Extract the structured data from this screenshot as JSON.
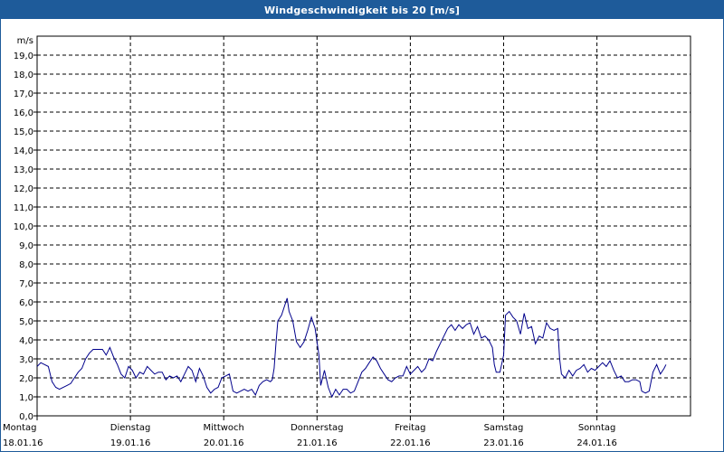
{
  "window": {
    "title": "Windgeschwindigkeit bis 20 [m/s]"
  },
  "colors": {
    "titlebar": "#1e5b9a",
    "series": "#00008b",
    "grid": "#000000"
  },
  "chart_data": {
    "type": "line",
    "title": "Windgeschwindigkeit bis 20 [m/s]",
    "ylabel": "m/s",
    "ylim": [
      0,
      20
    ],
    "y_ticks": [
      "0,0",
      "1,0",
      "2,0",
      "3,0",
      "4,0",
      "5,0",
      "6,0",
      "7,0",
      "8,0",
      "9,0",
      "10,0",
      "11,0",
      "12,0",
      "13,0",
      "14,0",
      "15,0",
      "16,0",
      "17,0",
      "18,0",
      "19,0"
    ],
    "x_range_days": [
      0,
      7
    ],
    "x_ticks": [
      {
        "day": "Montag",
        "date": "18.01.16"
      },
      {
        "day": "Dienstag",
        "date": "19.01.16"
      },
      {
        "day": "Mittwoch",
        "date": "20.01.16"
      },
      {
        "day": "Donnerstag",
        "date": "21.01.16"
      },
      {
        "day": "Freitag",
        "date": "22.01.16"
      },
      {
        "day": "Samstag",
        "date": "23.01.16"
      },
      {
        "day": "Sonntag",
        "date": "24.01.16"
      }
    ],
    "grid": true,
    "series": [
      {
        "values": [
          {
            "x": 0.0,
            "y": 2.6
          },
          {
            "x": 0.04,
            "y": 2.8
          },
          {
            "x": 0.12,
            "y": 2.6
          },
          {
            "x": 0.16,
            "y": 1.8
          },
          {
            "x": 0.2,
            "y": 1.5
          },
          {
            "x": 0.24,
            "y": 1.4
          },
          {
            "x": 0.32,
            "y": 1.6
          },
          {
            "x": 0.36,
            "y": 1.7
          },
          {
            "x": 0.4,
            "y": 2.0
          },
          {
            "x": 0.44,
            "y": 2.3
          },
          {
            "x": 0.48,
            "y": 2.5
          },
          {
            "x": 0.52,
            "y": 3.0
          },
          {
            "x": 0.56,
            "y": 3.3
          },
          {
            "x": 0.6,
            "y": 3.5
          },
          {
            "x": 0.66,
            "y": 3.5
          },
          {
            "x": 0.7,
            "y": 3.5
          },
          {
            "x": 0.74,
            "y": 3.2
          },
          {
            "x": 0.78,
            "y": 3.6
          },
          {
            "x": 0.82,
            "y": 3.1
          },
          {
            "x": 0.86,
            "y": 2.7
          },
          {
            "x": 0.9,
            "y": 2.2
          },
          {
            "x": 0.94,
            "y": 2.0
          },
          {
            "x": 0.98,
            "y": 2.6
          },
          {
            "x": 1.02,
            "y": 2.4
          },
          {
            "x": 1.06,
            "y": 2.0
          },
          {
            "x": 1.1,
            "y": 2.3
          },
          {
            "x": 1.14,
            "y": 2.2
          },
          {
            "x": 1.18,
            "y": 2.6
          },
          {
            "x": 1.22,
            "y": 2.4
          },
          {
            "x": 1.26,
            "y": 2.2
          },
          {
            "x": 1.3,
            "y": 2.3
          },
          {
            "x": 1.34,
            "y": 2.3
          },
          {
            "x": 1.38,
            "y": 1.9
          },
          {
            "x": 1.42,
            "y": 2.1
          },
          {
            "x": 1.46,
            "y": 2.0
          },
          {
            "x": 1.5,
            "y": 2.1
          },
          {
            "x": 1.54,
            "y": 1.8
          },
          {
            "x": 1.58,
            "y": 2.2
          },
          {
            "x": 1.62,
            "y": 2.6
          },
          {
            "x": 1.66,
            "y": 2.4
          },
          {
            "x": 1.7,
            "y": 1.8
          },
          {
            "x": 1.74,
            "y": 2.5
          },
          {
            "x": 1.78,
            "y": 2.1
          },
          {
            "x": 1.82,
            "y": 1.5
          },
          {
            "x": 1.86,
            "y": 1.2
          },
          {
            "x": 1.9,
            "y": 1.4
          },
          {
            "x": 1.94,
            "y": 1.5
          },
          {
            "x": 1.98,
            "y": 2.0
          },
          {
            "x": 2.02,
            "y": 2.1
          },
          {
            "x": 2.06,
            "y": 2.2
          },
          {
            "x": 2.1,
            "y": 1.3
          },
          {
            "x": 2.14,
            "y": 1.2
          },
          {
            "x": 2.18,
            "y": 1.3
          },
          {
            "x": 2.22,
            "y": 1.4
          },
          {
            "x": 2.26,
            "y": 1.3
          },
          {
            "x": 2.3,
            "y": 1.4
          },
          {
            "x": 2.34,
            "y": 1.1
          },
          {
            "x": 2.38,
            "y": 1.6
          },
          {
            "x": 2.42,
            "y": 1.8
          },
          {
            "x": 2.46,
            "y": 1.9
          },
          {
            "x": 2.5,
            "y": 1.8
          },
          {
            "x": 2.52,
            "y": 1.9
          },
          {
            "x": 2.54,
            "y": 2.5
          },
          {
            "x": 2.56,
            "y": 3.8
          },
          {
            "x": 2.58,
            "y": 5.0
          },
          {
            "x": 2.62,
            "y": 5.3
          },
          {
            "x": 2.66,
            "y": 5.9
          },
          {
            "x": 2.68,
            "y": 6.2
          },
          {
            "x": 2.7,
            "y": 5.5
          },
          {
            "x": 2.74,
            "y": 5.0
          },
          {
            "x": 2.78,
            "y": 3.9
          },
          {
            "x": 2.82,
            "y": 3.6
          },
          {
            "x": 2.86,
            "y": 3.9
          },
          {
            "x": 2.9,
            "y": 4.5
          },
          {
            "x": 2.94,
            "y": 5.2
          },
          {
            "x": 2.98,
            "y": 4.6
          },
          {
            "x": 3.02,
            "y": 3.2
          },
          {
            "x": 3.04,
            "y": 1.6
          },
          {
            "x": 3.08,
            "y": 2.4
          },
          {
            "x": 3.12,
            "y": 1.5
          },
          {
            "x": 3.16,
            "y": 1.0
          },
          {
            "x": 3.2,
            "y": 1.4
          },
          {
            "x": 3.24,
            "y": 1.1
          },
          {
            "x": 3.28,
            "y": 1.4
          },
          {
            "x": 3.32,
            "y": 1.4
          },
          {
            "x": 3.36,
            "y": 1.2
          },
          {
            "x": 3.4,
            "y": 1.3
          },
          {
            "x": 3.44,
            "y": 1.8
          },
          {
            "x": 3.48,
            "y": 2.3
          },
          {
            "x": 3.52,
            "y": 2.5
          },
          {
            "x": 3.56,
            "y": 2.8
          },
          {
            "x": 3.6,
            "y": 3.1
          },
          {
            "x": 3.64,
            "y": 2.9
          },
          {
            "x": 3.68,
            "y": 2.5
          },
          {
            "x": 3.72,
            "y": 2.2
          },
          {
            "x": 3.76,
            "y": 1.9
          },
          {
            "x": 3.8,
            "y": 1.8
          },
          {
            "x": 3.84,
            "y": 2.0
          },
          {
            "x": 3.88,
            "y": 2.1
          },
          {
            "x": 3.92,
            "y": 2.1
          },
          {
            "x": 3.96,
            "y": 2.6
          },
          {
            "x": 4.0,
            "y": 2.2
          },
          {
            "x": 4.04,
            "y": 2.4
          },
          {
            "x": 4.08,
            "y": 2.6
          },
          {
            "x": 4.12,
            "y": 2.3
          },
          {
            "x": 4.16,
            "y": 2.5
          },
          {
            "x": 4.2,
            "y": 3.0
          },
          {
            "x": 4.24,
            "y": 2.9
          },
          {
            "x": 4.28,
            "y": 3.4
          },
          {
            "x": 4.32,
            "y": 3.8
          },
          {
            "x": 4.36,
            "y": 4.2
          },
          {
            "x": 4.4,
            "y": 4.6
          },
          {
            "x": 4.44,
            "y": 4.8
          },
          {
            "x": 4.48,
            "y": 4.5
          },
          {
            "x": 4.52,
            "y": 4.8
          },
          {
            "x": 4.56,
            "y": 4.6
          },
          {
            "x": 4.6,
            "y": 4.8
          },
          {
            "x": 4.64,
            "y": 4.9
          },
          {
            "x": 4.68,
            "y": 4.3
          },
          {
            "x": 4.72,
            "y": 4.7
          },
          {
            "x": 4.76,
            "y": 4.1
          },
          {
            "x": 4.8,
            "y": 4.2
          },
          {
            "x": 4.84,
            "y": 4.0
          },
          {
            "x": 4.88,
            "y": 3.6
          },
          {
            "x": 4.9,
            "y": 2.7
          },
          {
            "x": 4.92,
            "y": 2.3
          },
          {
            "x": 4.96,
            "y": 2.3
          },
          {
            "x": 5.0,
            "y": 3.2
          },
          {
            "x": 5.02,
            "y": 5.3
          },
          {
            "x": 5.06,
            "y": 5.5
          },
          {
            "x": 5.1,
            "y": 5.2
          },
          {
            "x": 5.14,
            "y": 5.0
          },
          {
            "x": 5.18,
            "y": 4.3
          },
          {
            "x": 5.22,
            "y": 5.4
          },
          {
            "x": 5.26,
            "y": 4.6
          },
          {
            "x": 5.3,
            "y": 4.7
          },
          {
            "x": 5.34,
            "y": 3.8
          },
          {
            "x": 5.38,
            "y": 4.2
          },
          {
            "x": 5.42,
            "y": 4.1
          },
          {
            "x": 5.46,
            "y": 4.9
          },
          {
            "x": 5.5,
            "y": 4.6
          },
          {
            "x": 5.54,
            "y": 4.5
          },
          {
            "x": 5.58,
            "y": 4.6
          },
          {
            "x": 5.6,
            "y": 3.0
          },
          {
            "x": 5.62,
            "y": 2.2
          },
          {
            "x": 5.66,
            "y": 2.0
          },
          {
            "x": 5.7,
            "y": 2.4
          },
          {
            "x": 5.74,
            "y": 2.1
          },
          {
            "x": 5.78,
            "y": 2.4
          },
          {
            "x": 5.82,
            "y": 2.5
          },
          {
            "x": 5.86,
            "y": 2.7
          },
          {
            "x": 5.9,
            "y": 2.3
          },
          {
            "x": 5.94,
            "y": 2.5
          },
          {
            "x": 5.98,
            "y": 2.4
          },
          {
            "x": 6.02,
            "y": 2.6
          },
          {
            "x": 6.06,
            "y": 2.8
          },
          {
            "x": 6.1,
            "y": 2.6
          },
          {
            "x": 6.14,
            "y": 2.9
          },
          {
            "x": 6.18,
            "y": 2.4
          },
          {
            "x": 6.22,
            "y": 2.0
          },
          {
            "x": 6.26,
            "y": 2.1
          },
          {
            "x": 6.3,
            "y": 1.8
          },
          {
            "x": 6.34,
            "y": 1.8
          },
          {
            "x": 6.38,
            "y": 1.9
          },
          {
            "x": 6.42,
            "y": 1.9
          },
          {
            "x": 6.46,
            "y": 1.8
          },
          {
            "x": 6.48,
            "y": 1.3
          },
          {
            "x": 6.52,
            "y": 1.2
          },
          {
            "x": 6.56,
            "y": 1.3
          },
          {
            "x": 6.6,
            "y": 2.3
          },
          {
            "x": 6.64,
            "y": 2.7
          },
          {
            "x": 6.68,
            "y": 2.2
          },
          {
            "x": 6.72,
            "y": 2.5
          },
          {
            "x": 6.74,
            "y": 2.7
          }
        ]
      }
    ]
  }
}
